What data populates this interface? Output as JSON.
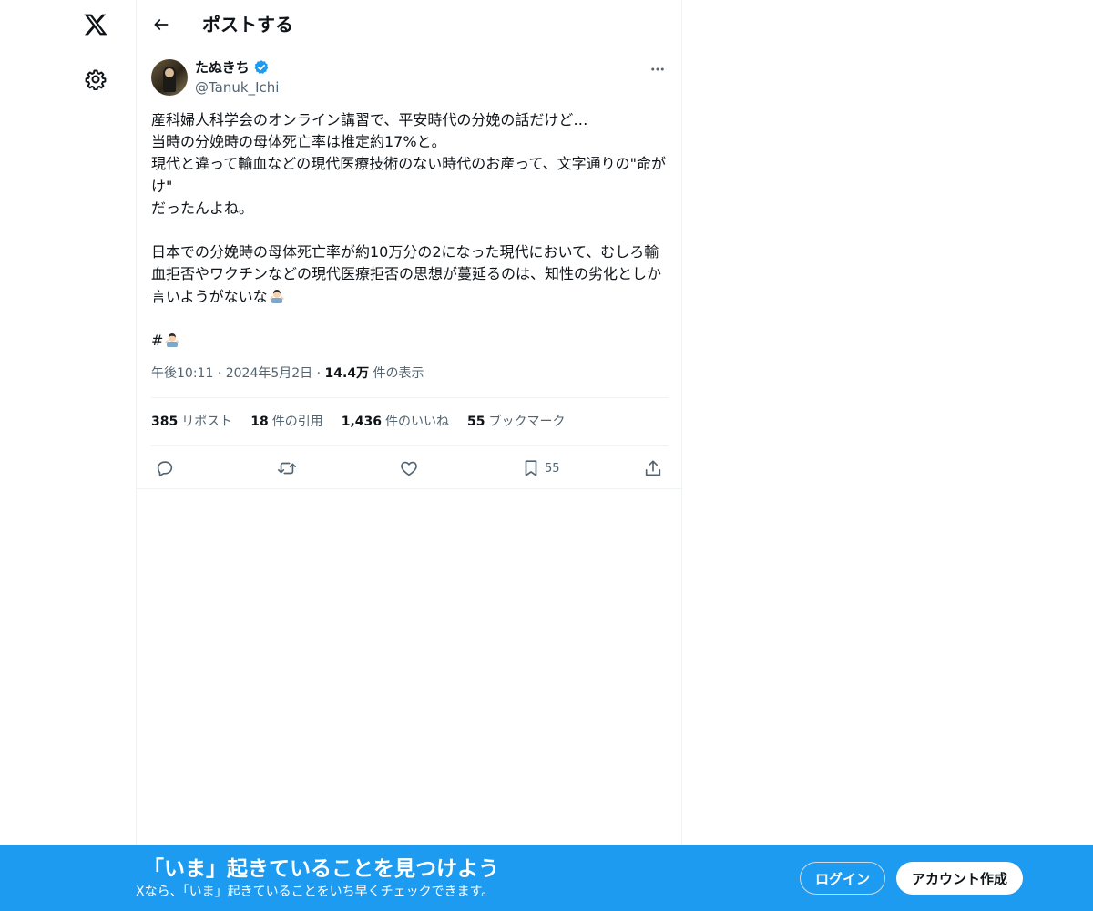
{
  "header": {
    "title": "ポストする"
  },
  "author": {
    "name": "たぬきち",
    "handle": "@Tanuk_Ichi"
  },
  "tweet": {
    "text": "産科婦人科学会のオンライン講習で、平安時代の分娩の話だけど…\n当時の分娩時の母体死亡率は推定約17%と。\n現代と違って輸血などの現代医療技術のない時代のお産って、文字通りの\"命がけ\"\nだったんよね。\n\n日本での分娩時の母体死亡率が約10万分の2になった現代において、むしろ輸血拒否やワクチンなどの現代医療拒否の思想が蔓延るのは、知性の劣化としか言いようがないな",
    "hashtag_prefix": "#"
  },
  "meta": {
    "time": "午後10:11",
    "sep": "·",
    "date": "2024年5月2日",
    "views_count": "14.4万",
    "views_label": "件の表示"
  },
  "stats": {
    "reposts_count": "385",
    "reposts_label": "リポスト",
    "quotes_count": "18",
    "quotes_label": "件の引用",
    "likes_count": "1,436",
    "likes_label": "件のいいね",
    "bookmarks_count": "55",
    "bookmarks_label": "ブックマーク"
  },
  "actions": {
    "bookmark_count": "55",
    "icons": [
      "reply-icon",
      "repost-icon",
      "like-icon",
      "bookmark-icon",
      "share-icon"
    ]
  },
  "banner": {
    "title": "「いま」起きていることを見つけよう",
    "subtitle": "Xなら、「いま」起きていることをいち早くチェックできます。",
    "login_label": "ログイン",
    "signup_label": "アカウント作成"
  },
  "colors": {
    "accent": "#1d9bf0",
    "text": "#0f1419",
    "secondary_text": "#536471",
    "border": "#eff3f4"
  }
}
